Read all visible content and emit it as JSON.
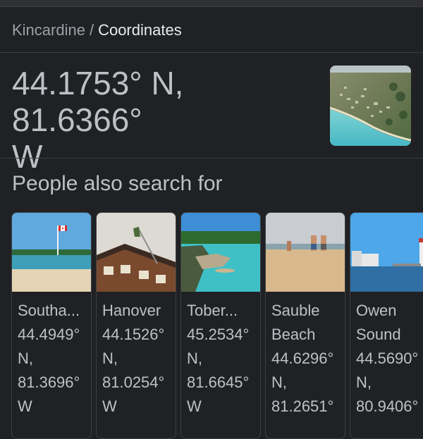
{
  "breadcrumb": {
    "root": "Kincardine",
    "separator": "/",
    "current": "Coordinates"
  },
  "answer": {
    "line1": "44.1753° N, 81.6366°",
    "line2": "W"
  },
  "thumbnail": {
    "icon": "aerial-town-photo"
  },
  "people_also_search": {
    "title": "People also search for",
    "cards": [
      {
        "name_lines": [
          "Southa..."
        ],
        "coord_lines": [
          "44.4949°",
          "N,",
          "81.3696°",
          "W"
        ],
        "image": "beach-with-canadian-flag-photo"
      },
      {
        "name_lines": [
          "Hanover"
        ],
        "coord_lines": [
          "44.1526°",
          "N,",
          "81.0254°",
          "W"
        ],
        "image": "brick-building-with-flag-photo"
      },
      {
        "name_lines": [
          "Tober..."
        ],
        "coord_lines": [
          "45.2534°",
          "N,",
          "81.6645°",
          "W"
        ],
        "image": "turquoise-cove-photo"
      },
      {
        "name_lines": [
          "Sauble",
          "Beach"
        ],
        "coord_lines": [
          "44.6296°",
          "N,",
          "81.2651°"
        ],
        "image": "sandy-beach-people-photo"
      },
      {
        "name_lines": [
          "Owen",
          "Sound"
        ],
        "coord_lines": [
          "44.5690°",
          "N,",
          "80.9406°"
        ],
        "image": "harbour-lighthouse-photo"
      }
    ]
  },
  "colors": {
    "background": "#202124",
    "text_primary": "#e8eaed",
    "text_secondary": "#bdc1c6",
    "text_muted": "#9aa0a6",
    "divider": "#3c4043"
  }
}
